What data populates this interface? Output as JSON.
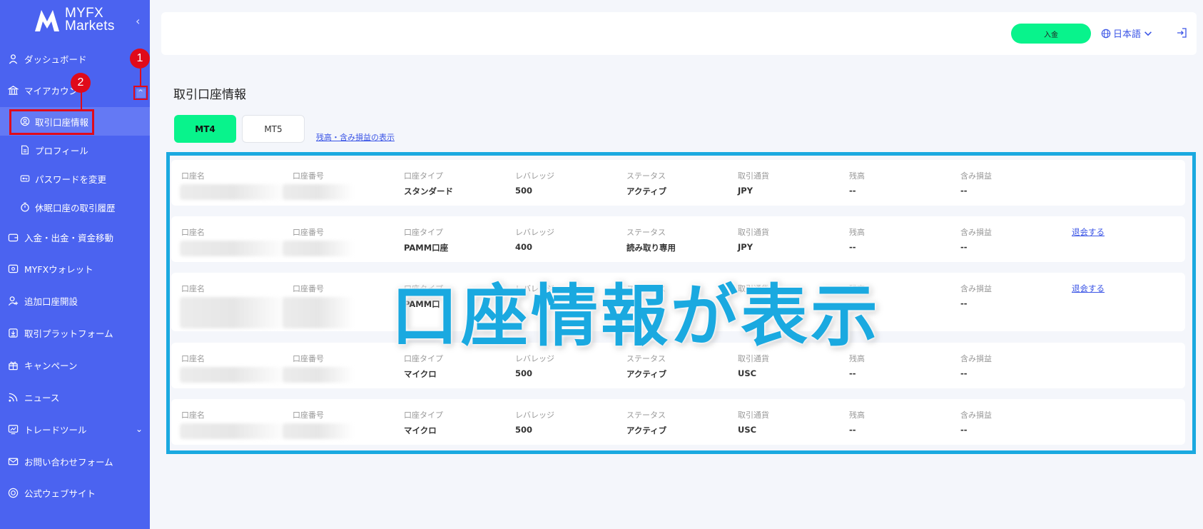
{
  "sidebar": {
    "logo": {
      "line1": "MYFX",
      "line2": "Markets"
    },
    "collapse_icon": "chevron-left-icon",
    "items": [
      {
        "label": "ダッシュボード",
        "icon": "user-icon"
      },
      {
        "label": "マイアカウント",
        "icon": "bank-icon"
      },
      {
        "label": "入金・出金・資金移動",
        "icon": "wallet-icon"
      },
      {
        "label": "MYFXウォレット",
        "icon": "wallet-square-icon"
      },
      {
        "label": "追加口座開設",
        "icon": "user-add-icon"
      },
      {
        "label": "取引プラットフォーム",
        "icon": "download-icon"
      },
      {
        "label": "キャンペーン",
        "icon": "gift-icon"
      },
      {
        "label": "ニュース",
        "icon": "rss-icon"
      },
      {
        "label": "トレードツール",
        "icon": "chart-icon"
      },
      {
        "label": "お問い合わせフォーム",
        "icon": "mail-icon"
      },
      {
        "label": "公式ウェブサイト",
        "icon": "globe-icon"
      }
    ],
    "sub_items": [
      {
        "label": "取引口座情報",
        "icon": "user-circle-icon",
        "active": true
      },
      {
        "label": "プロフィール",
        "icon": "document-icon"
      },
      {
        "label": "パスワードを変更",
        "icon": "key-icon"
      },
      {
        "label": "休眠口座の取引履歴",
        "icon": "timer-icon"
      }
    ],
    "my_account_truncated": "マイアカウン"
  },
  "callouts": {
    "badge1": "1",
    "badge2": "2"
  },
  "topbar": {
    "deposit_label": "入金",
    "language": "日本語",
    "language_icon": "globe-icon",
    "logout_icon": "logout-icon"
  },
  "main": {
    "title": "取引口座情報",
    "tabs": [
      {
        "label": "MT4",
        "active": true
      },
      {
        "label": "MT5",
        "active": false
      }
    ],
    "balance_link": "残高・含み損益の表示",
    "overlay_text": "口座情報が表示"
  },
  "accounts": {
    "headers": [
      "口座名",
      "口座番号",
      "口座タイプ",
      "レバレッジ",
      "ステータス",
      "取引通貨",
      "残高",
      "含み損益"
    ],
    "withdraw_label": "退会する",
    "rows": [
      {
        "type": "スタンダード",
        "leverage": "500",
        "status": "アクティブ",
        "currency": "JPY",
        "balance": "--",
        "pnl": "--",
        "withdraw": false
      },
      {
        "type": "PAMM口座",
        "leverage": "400",
        "status": "読み取り専用",
        "currency": "JPY",
        "balance": "--",
        "pnl": "--",
        "withdraw": true
      },
      {
        "type": "PAMM口",
        "leverage": "",
        "status": "",
        "currency": "",
        "balance": "",
        "pnl": "--",
        "withdraw": true
      },
      {
        "type": "マイクロ",
        "leverage": "500",
        "status": "アクティブ",
        "currency": "USC",
        "balance": "--",
        "pnl": "--",
        "withdraw": false
      },
      {
        "type": "マイクロ",
        "leverage": "500",
        "status": "アクティブ",
        "currency": "USC",
        "balance": "--",
        "pnl": "--",
        "withdraw": false
      }
    ]
  },
  "colors": {
    "sidebar": "#4b63f0",
    "accent_green": "#08f38c",
    "highlight_blue": "#1aa9e0",
    "callout_red": "#e00a1a",
    "link_blue": "#3b55e6"
  }
}
